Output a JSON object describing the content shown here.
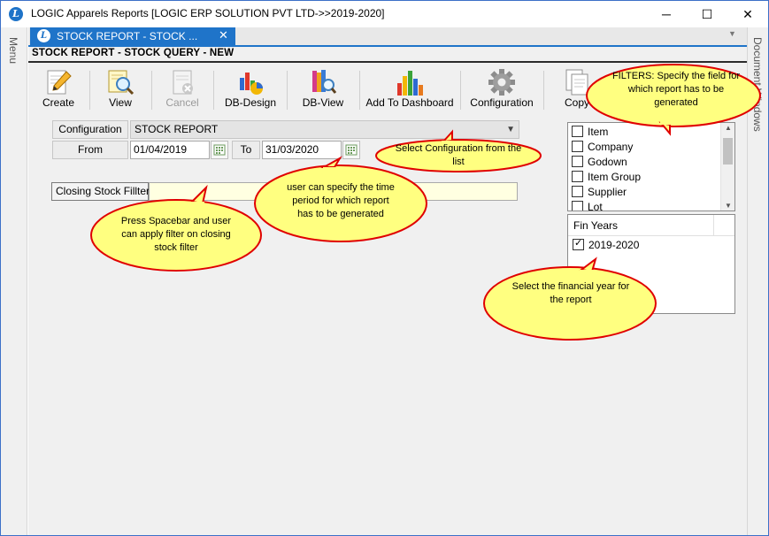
{
  "window": {
    "title": "LOGIC Apparels Reports  [LOGIC ERP SOLUTION PVT LTD->>2019-2020]",
    "app_icon": "L",
    "controls": {
      "minimize": "─",
      "maximize": "☐",
      "close": "✕"
    }
  },
  "side": {
    "left_label": "Menu",
    "right_label": "Document Windows"
  },
  "tab": {
    "label": "STOCK REPORT - STOCK ...",
    "icon": "L",
    "close": "✕"
  },
  "page": {
    "heading": "STOCK REPORT - STOCK QUERY - NEW"
  },
  "toolbar": {
    "create": "Create",
    "view": "View",
    "cancel": "Cancel",
    "db_design": "DB-Design",
    "db_view": "DB-View",
    "add_dashboard": "Add To Dashboard",
    "configuration": "Configuration",
    "copy": "Copy"
  },
  "form": {
    "configuration_label": "Configuration",
    "configuration_value": "STOCK REPORT",
    "from_label": "From",
    "from_value": "01/04/2019",
    "to_label": "To",
    "to_value": "31/03/2020",
    "closing_filter_label": "Closing Stock Fillter"
  },
  "filters": {
    "items": [
      "Item",
      "Company",
      "Godown",
      "Item Group",
      "Supplier",
      "Lot"
    ]
  },
  "fin_years": {
    "header": "Fin Years",
    "items": [
      {
        "label": "2019-2020",
        "checked": true
      }
    ]
  },
  "callouts": {
    "filters": "FILTERS: Specify the field for which report has to be generated",
    "configuration": "Select Configuration from the list",
    "period": "user can specify the time period for which report has to be generated",
    "spacebar": "Press Spacebar and user can apply filter on closing stock filter",
    "fin_year": "Select the financial year for the report"
  },
  "colors": {
    "accent": "#1f74c9",
    "callout_fill": "#ffff80",
    "callout_border": "#e00000",
    "panel_bg": "#f0f0f0"
  }
}
